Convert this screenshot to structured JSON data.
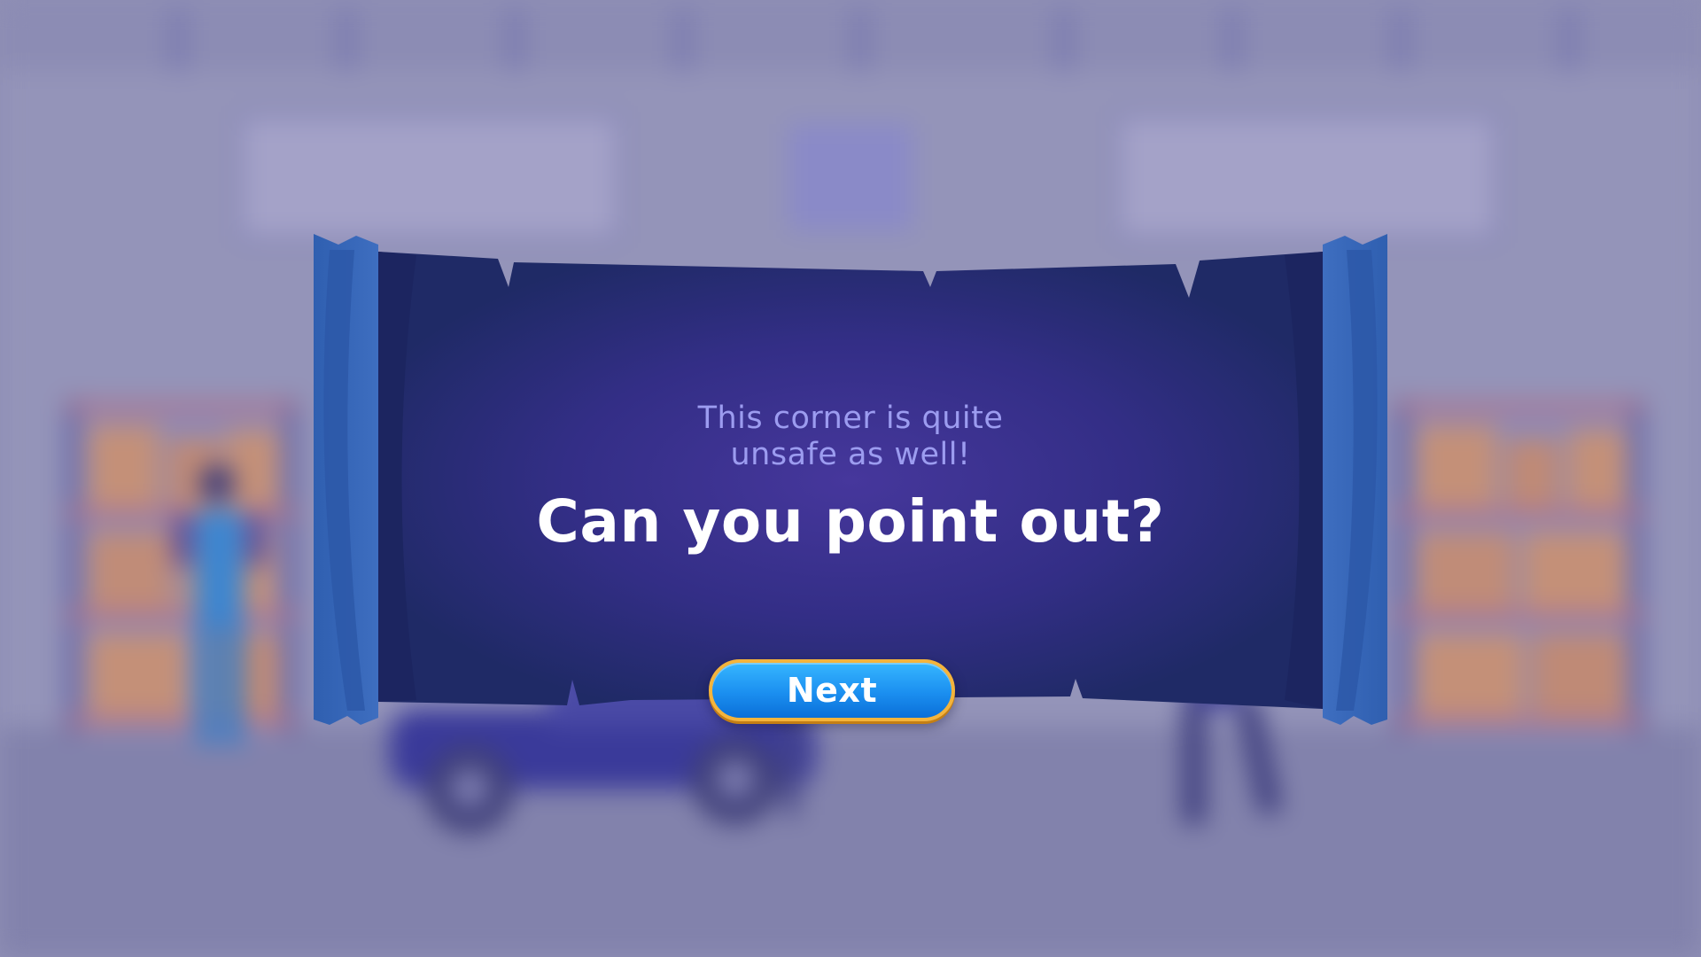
{
  "dialog": {
    "subtitle": "This corner is quite\nunsafe as well!",
    "headline": "Can you point out?",
    "next_label": "Next"
  },
  "colors": {
    "banner_dark": "#1f2a66",
    "banner_glow": "#45359a",
    "curtain_blue": "#3262b4",
    "subtitle": "#9c9cf0",
    "button_blue": "#1b8ff0",
    "button_border": "#f4b43c",
    "background": "#8f8fb5"
  }
}
